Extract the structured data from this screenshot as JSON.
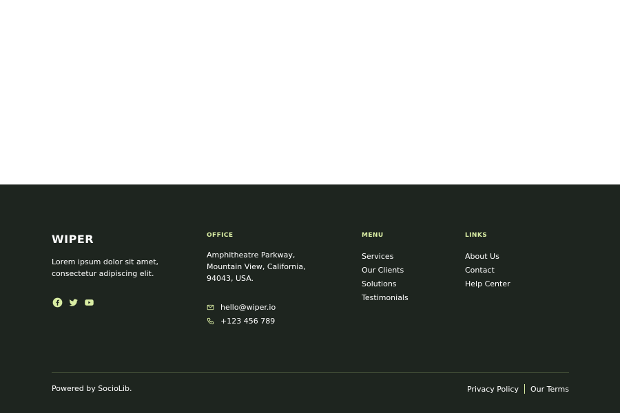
{
  "colors": {
    "footer_bg": "#1e251f",
    "accent": "#d9eda3",
    "text": "#ffffff",
    "divider": "#47543a"
  },
  "brand": {
    "name": "WIPER",
    "description": "Lorem ipsum dolor sit amet, consectetur adipiscing elit."
  },
  "socials": [
    {
      "icon": "facebook-icon"
    },
    {
      "icon": "twitter-icon"
    },
    {
      "icon": "youtube-icon"
    }
  ],
  "office": {
    "title": "OFFICE",
    "address": "Amphitheatre Parkway, Mountain View, California, 94043, USA.",
    "email": "hello@wiper.io",
    "phone": "+123 456 789"
  },
  "menu": {
    "title": "MENU",
    "items": [
      "Services",
      "Our Clients",
      "Solutions",
      "Testimonials"
    ]
  },
  "links": {
    "title": "LINKS",
    "items": [
      "About Us",
      "Contact",
      "Help Center"
    ]
  },
  "bottom": {
    "powered": "Powered by SocioLib.",
    "privacy": "Privacy Policy",
    "terms": "Our Terms"
  }
}
